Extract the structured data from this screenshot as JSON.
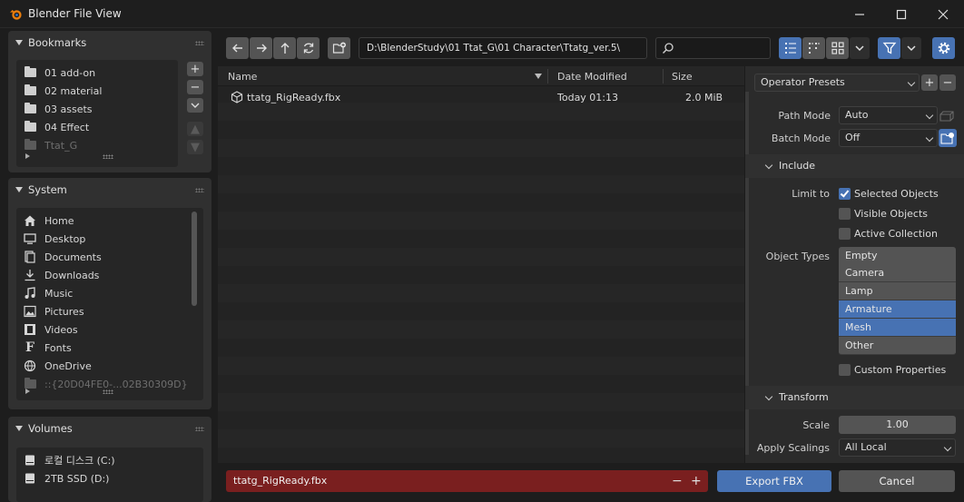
{
  "window": {
    "title": "Blender File View"
  },
  "bookmarks": {
    "title": "Bookmarks",
    "items": [
      {
        "label": "01 add-on"
      },
      {
        "label": "02 material"
      },
      {
        "label": "03 assets"
      },
      {
        "label": "04 Effect"
      },
      {
        "label": "Ttat_G"
      }
    ]
  },
  "system": {
    "title": "System",
    "items": [
      {
        "label": "Home",
        "icon": "home-icon"
      },
      {
        "label": "Desktop",
        "icon": "desktop-icon"
      },
      {
        "label": "Documents",
        "icon": "documents-icon"
      },
      {
        "label": "Downloads",
        "icon": "downloads-icon"
      },
      {
        "label": "Music",
        "icon": "music-icon"
      },
      {
        "label": "Pictures",
        "icon": "pictures-icon"
      },
      {
        "label": "Videos",
        "icon": "videos-icon"
      },
      {
        "label": "Fonts",
        "icon": "fonts-icon"
      },
      {
        "label": "OneDrive",
        "icon": "onedrive-icon"
      },
      {
        "label": "::{20D04FE0-...02B30309D}",
        "icon": "folder-icon"
      }
    ]
  },
  "volumes": {
    "title": "Volumes",
    "items": [
      {
        "label": "로컬 디스크 (C:)"
      },
      {
        "label": "2TB SSD (D:)"
      }
    ]
  },
  "toolbar": {
    "path": "D:\\BlenderStudy\\01 Ttat_G\\01 Character\\Ttatg_ver.5\\",
    "search_placeholder": ""
  },
  "filelist": {
    "columns": {
      "name": "Name",
      "date": "Date Modified",
      "size": "Size"
    },
    "rows": [
      {
        "name": "ttatg_RigReady.fbx",
        "date": "Today 01:13",
        "size": "2.0 MiB"
      }
    ]
  },
  "bottom": {
    "filename": "ttatg_RigReady.fbx",
    "export_label": "Export FBX",
    "cancel_label": "Cancel"
  },
  "options": {
    "presets": "Operator Presets",
    "path_mode_label": "Path Mode",
    "path_mode_value": "Auto",
    "batch_mode_label": "Batch Mode",
    "batch_mode_value": "Off",
    "include_title": "Include",
    "limit_to_label": "Limit to",
    "selected_objects": "Selected Objects",
    "visible_objects": "Visible Objects",
    "active_collection": "Active Collection",
    "object_types_label": "Object Types",
    "object_types": [
      {
        "label": "Empty",
        "selected": false
      },
      {
        "label": "Camera",
        "selected": false
      },
      {
        "label": "Lamp",
        "selected": false
      },
      {
        "label": "Armature",
        "selected": true
      },
      {
        "label": "Mesh",
        "selected": true
      },
      {
        "label": "Other",
        "selected": false
      }
    ],
    "custom_properties": "Custom Properties",
    "transform_title": "Transform",
    "scale_label": "Scale",
    "scale_value": "1.00",
    "apply_scalings_label": "Apply Scalings",
    "apply_scalings_value": "All Local"
  },
  "colors": {
    "accent": "#4772b3",
    "filename_bg": "#7a1f1f"
  }
}
